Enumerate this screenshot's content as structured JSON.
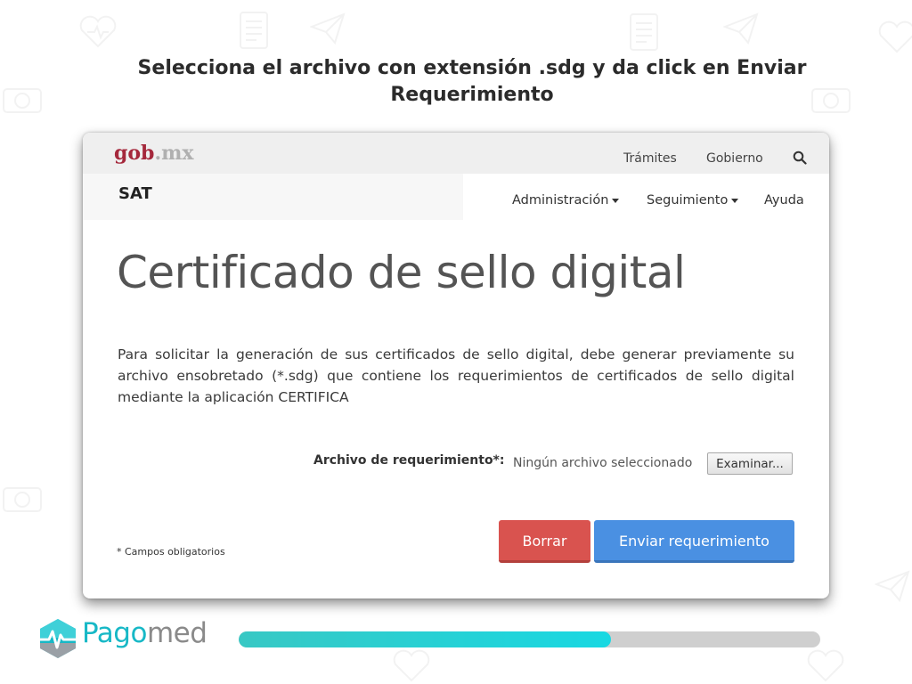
{
  "title": "Selecciona el archivo con extensión .sdg y da click en Enviar Requerimiento",
  "card": {
    "logo": {
      "main": "gob",
      "suffix": ".mx"
    },
    "top_links": [
      "Trámites",
      "Gobierno"
    ],
    "site_name": "SAT",
    "nav": {
      "items": [
        {
          "label": "Administración",
          "dropdown": true
        },
        {
          "label": "Seguimiento",
          "dropdown": true
        },
        {
          "label": "Ayuda",
          "dropdown": false
        }
      ]
    },
    "heading": "Certificado de sello digital",
    "description": "Para solicitar la generación de sus certificados de sello digital, debe generar previamente su archivo ensobretado (*.sdg) que contiene los requerimientos de certificados de sello digital mediante la aplicación CERTIFICA",
    "file_field": {
      "label": "Archivo de requerimiento*:",
      "status": "Ningún archivo seleccionado",
      "browse_label": "Examinar..."
    },
    "required_note": "* Campos obligatorios",
    "buttons": {
      "delete": "Borrar",
      "send": "Enviar requerimiento"
    }
  },
  "footer": {
    "brand": {
      "part1": "Pago",
      "part2": "med"
    },
    "progress": 0.64
  },
  "colors": {
    "gob_red": "#a5283c",
    "delete_button": "#d9534f",
    "send_button": "#4a90e2",
    "brand_teal": "#17b8c6",
    "progress_fill": "#18d8e2"
  },
  "icons": [
    "search-icon",
    "caret-down-icon",
    "pagomed-logo-icon"
  ]
}
